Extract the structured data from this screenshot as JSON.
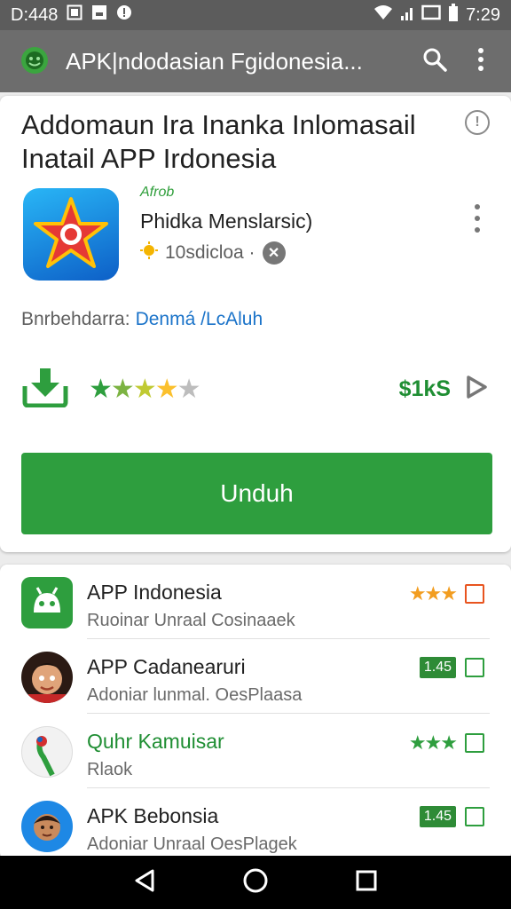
{
  "status_bar": {
    "left_text": "D:448",
    "time": "7:29"
  },
  "app_bar": {
    "title": "APK|ndodasian Fgidonesia...",
    "search_icon": "search-icon",
    "more_icon": "more-vert-icon"
  },
  "detail": {
    "title": "Addomaun Ira Inanka Inlomasail Inatail APP Irdonesia",
    "developer_tag": "Afrob",
    "app_name": "Phidka Menslarsic)",
    "downloads": "10sdicloa ·",
    "category_label": "Bnrbehdarra:",
    "category_value": "Denmá /LcAluh",
    "price": "$1kS",
    "rating": 4,
    "install_label": "Unduh",
    "colors": {
      "accent": "#2e9e3e",
      "link": "#1a73c9",
      "star": "#2e9e3e"
    }
  },
  "list": [
    {
      "title": "APP Indonesia",
      "subtitle": "Ruoinar Unraal Cosinaaek",
      "badge": "",
      "stars": "★★★",
      "title_color": "#212121"
    },
    {
      "title": "APP Cadanearuri",
      "subtitle": "Adoniar lunmal. OesPlaasa",
      "badge": "1.45",
      "stars": "",
      "title_color": "#212121"
    },
    {
      "title": "Quhr Kamuisar",
      "subtitle": "Rlaok",
      "badge": "",
      "stars": "★★★",
      "title_color": "#1f8e33"
    },
    {
      "title": "APK Bebonsia",
      "subtitle": "Adoniar Unraal OesPlagek",
      "badge": "1.45",
      "stars": "",
      "title_color": "#212121"
    }
  ]
}
